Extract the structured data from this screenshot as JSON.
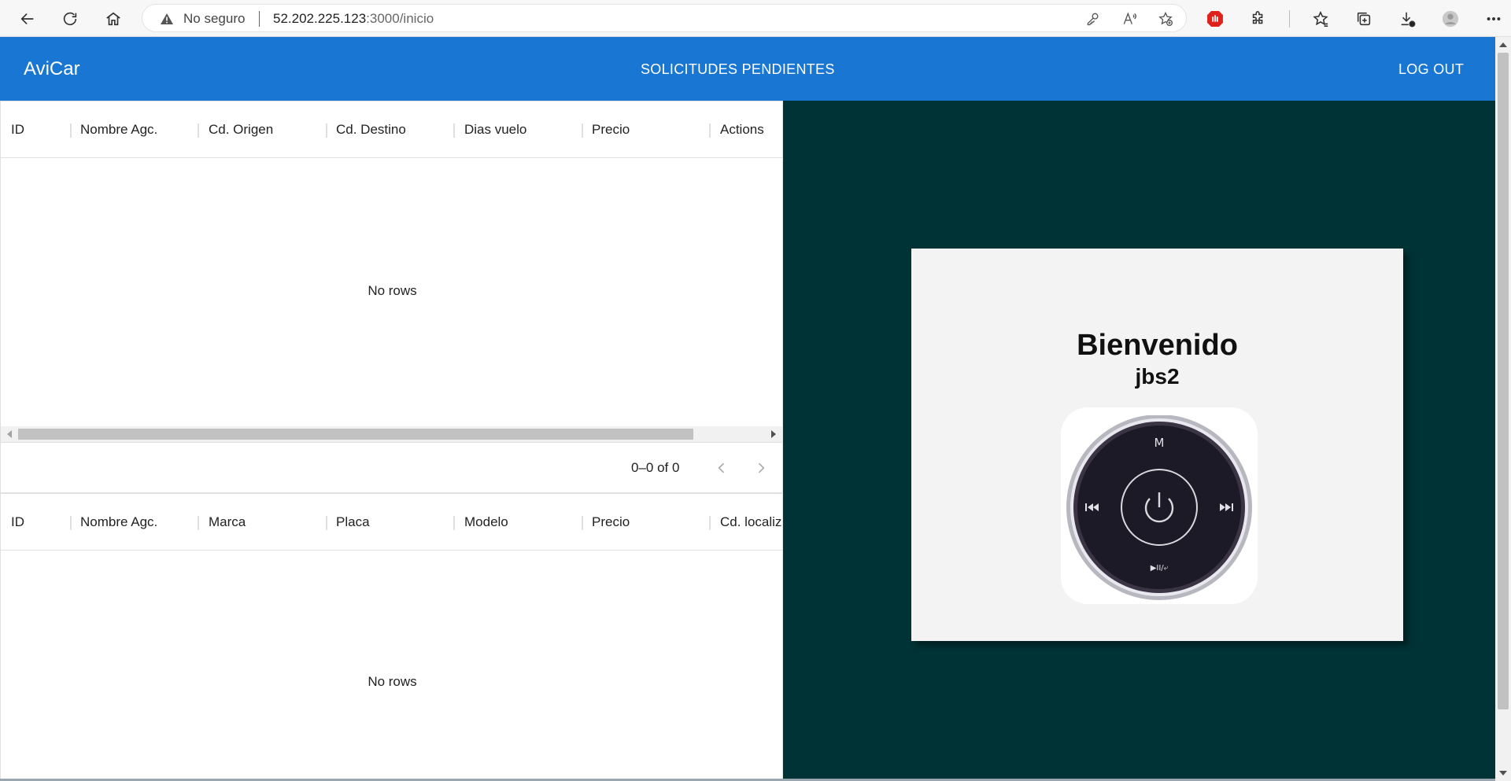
{
  "browser": {
    "security_label": "No seguro",
    "url_host": "52.202.225.123",
    "url_rest": ":3000/inicio"
  },
  "header": {
    "brand": "AviCar",
    "pending_link": "SOLICITUDES PENDIENTES",
    "logout_link": "LOG OUT"
  },
  "flights_table": {
    "columns": [
      "ID",
      "Nombre Agc.",
      "Cd. Origen",
      "Cd. Destino",
      "Dias vuelo",
      "Precio",
      "Actions"
    ],
    "empty_text": "No rows",
    "pagination": "0–0 of 0"
  },
  "cars_table": {
    "columns": [
      "ID",
      "Nombre Agc.",
      "Marca",
      "Placa",
      "Modelo",
      "Precio",
      "Cd. localiz"
    ],
    "empty_text": "No rows"
  },
  "welcome": {
    "title": "Bienvenido",
    "username": "jbs2",
    "remote_label_mode": "M",
    "remote_label_play": "▶II/⤶"
  },
  "colors": {
    "app_bar": "#1976d2",
    "right_panel": "#003335",
    "card": "#f3f3f3"
  }
}
